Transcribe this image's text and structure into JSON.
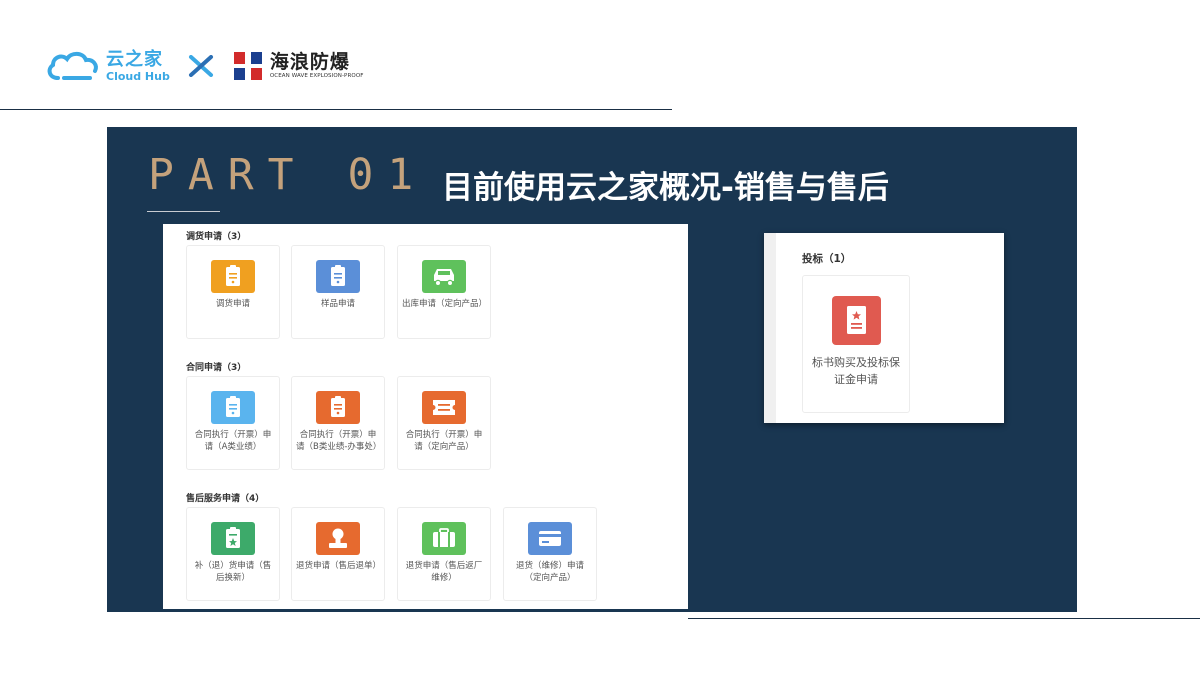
{
  "header": {
    "cloudhub_cn": "云之家",
    "cloudhub_en": "Cloud Hub",
    "partner_cn": "海浪防爆",
    "partner_en": "OCEAN WAVE EXPLOSION-PROOF"
  },
  "slide": {
    "part": "PART 01",
    "title": "目前使用云之家概况-销售与售后"
  },
  "colors": {
    "navy": "#193651",
    "gold": "#c4a27c",
    "orange": "#f0a020",
    "blue": "#5b8fd8",
    "green": "#5fc15c",
    "sky": "#5ab4ee",
    "red_orange": "#e66a2f",
    "dark_green": "#3daa6a",
    "red": "#e05a50"
  },
  "groups": [
    {
      "label": "调货申请（3）",
      "items": [
        {
          "label": "调货申请",
          "icon": "clipboard-icon",
          "color": "#f0a020"
        },
        {
          "label": "样品申请",
          "icon": "clipboard-icon",
          "color": "#5b8fd8"
        },
        {
          "label": "出库申请（定向产品）",
          "icon": "truck-icon",
          "color": "#5fc15c"
        }
      ]
    },
    {
      "label": "合同申请（3）",
      "items": [
        {
          "label": "合同执行（开票）申请（A类业绩）",
          "icon": "clipboard-icon",
          "color": "#5ab4ee"
        },
        {
          "label": "合同执行（开票）申请（B类业绩-办事处）",
          "icon": "clipboard-icon",
          "color": "#e66a2f"
        },
        {
          "label": "合同执行（开票）申请（定向产品）",
          "icon": "ticket-icon",
          "color": "#e66a2f"
        }
      ]
    },
    {
      "label": "售后服务申请（4）",
      "items": [
        {
          "label": "补（退）货申请（售后换新）",
          "icon": "clipboard-star-icon",
          "color": "#3daa6a"
        },
        {
          "label": "退货申请（售后退单）",
          "icon": "stamp-icon",
          "color": "#e66a2f"
        },
        {
          "label": "退货申请（售后返厂维修）",
          "icon": "briefcase-icon",
          "color": "#5fc15c"
        },
        {
          "label": "退货（维修）申请（定向产品）",
          "icon": "card-icon",
          "color": "#5b8fd8"
        }
      ]
    }
  ],
  "bid": {
    "label": "投标（1）",
    "item": {
      "label": "标书购买及投标保证金申请",
      "icon": "document-star-icon",
      "color": "#e05a50"
    }
  }
}
